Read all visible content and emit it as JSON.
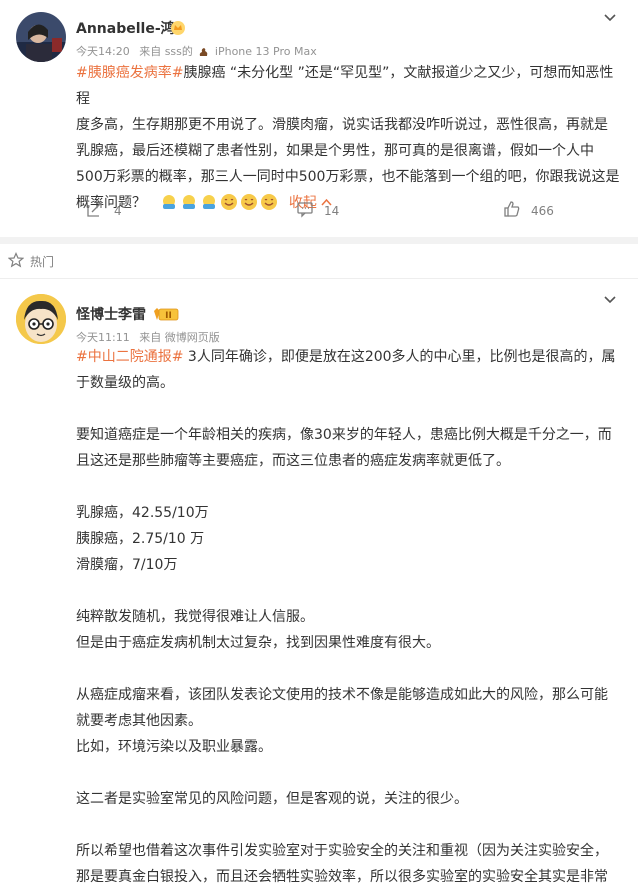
{
  "post1": {
    "username": "Annabelle-鸿",
    "time": "今天14:20",
    "source": "来自 sss的",
    "device": "iPhone 13 Pro Max",
    "hashtag": "#胰腺癌发病率#",
    "lines": [
      "胰腺癌 “未分化型 ”还是“罕见型”，文献报道少之又少，可想而知恶性程",
      "度多高，生存期那更不用说了。滑膜肉瘤，说实话我都没咋听说过，恶性很高，再就是",
      "乳腺癌，最后还模糊了患者性别，如果是个男性，那可真的是很离谱，假如一个人中",
      "500万彩票的概率，那三人一同时中500万彩票，也不能落到一个组的吧，你跟我说这是",
      "概率问题？"
    ],
    "collapse_label": "收起",
    "repost_count": "4",
    "comment_count": "14",
    "like_count": "466"
  },
  "section": {
    "hot_label": "热门"
  },
  "post2": {
    "username": "怪博士李雷",
    "level_badge": "II",
    "time": "今天11:11",
    "source": "来自 微博网页版",
    "hashtag": "#中山二院通报#",
    "first_line_rest": " 3人同年确诊，即便是放在这200多人的中心里，比例也是很高的，属",
    "line2": "于数量级的高。",
    "p2_line1": "要知道癌症是一个年龄相关的疾病，像30来岁的年轻人，患癌比例大概是千分之一，而",
    "p2_line2": "且这还是那些肺瘤等主要癌症，而这三位患者的癌症发病率就更低了。",
    "stat1": "乳腺癌，42.55/10万",
    "stat2": "胰腺癌，2.75/10 万",
    "stat3": "滑膜瘤，7/10万",
    "p4_line1": "纯粹散发随机，我觉得很难让人信服。",
    "p4_line2": "但是由于癌症发病机制太过复杂，找到因果性难度有很大。",
    "p5_line1": "从癌症成瘤来看，该团队发表论文使用的技术不像是能够造成如此大的风险，那么可能",
    "p5_line2": "就要考虑其他因素。",
    "p5_line3": "比如，环境污染以及职业暴露。",
    "p6_line1": "这二者是实验室常见的风险问题，但是客观的说，关注的很少。",
    "p7_line1": "所以希望也借着这次事件引发实验室对于实验安全的关注和重视（因为关注实验安全，",
    "p7_line2": "那是要真金白银投入，而且还会牺牲实验效率，所以很多实验室的实验安全其实是非常"
  }
}
